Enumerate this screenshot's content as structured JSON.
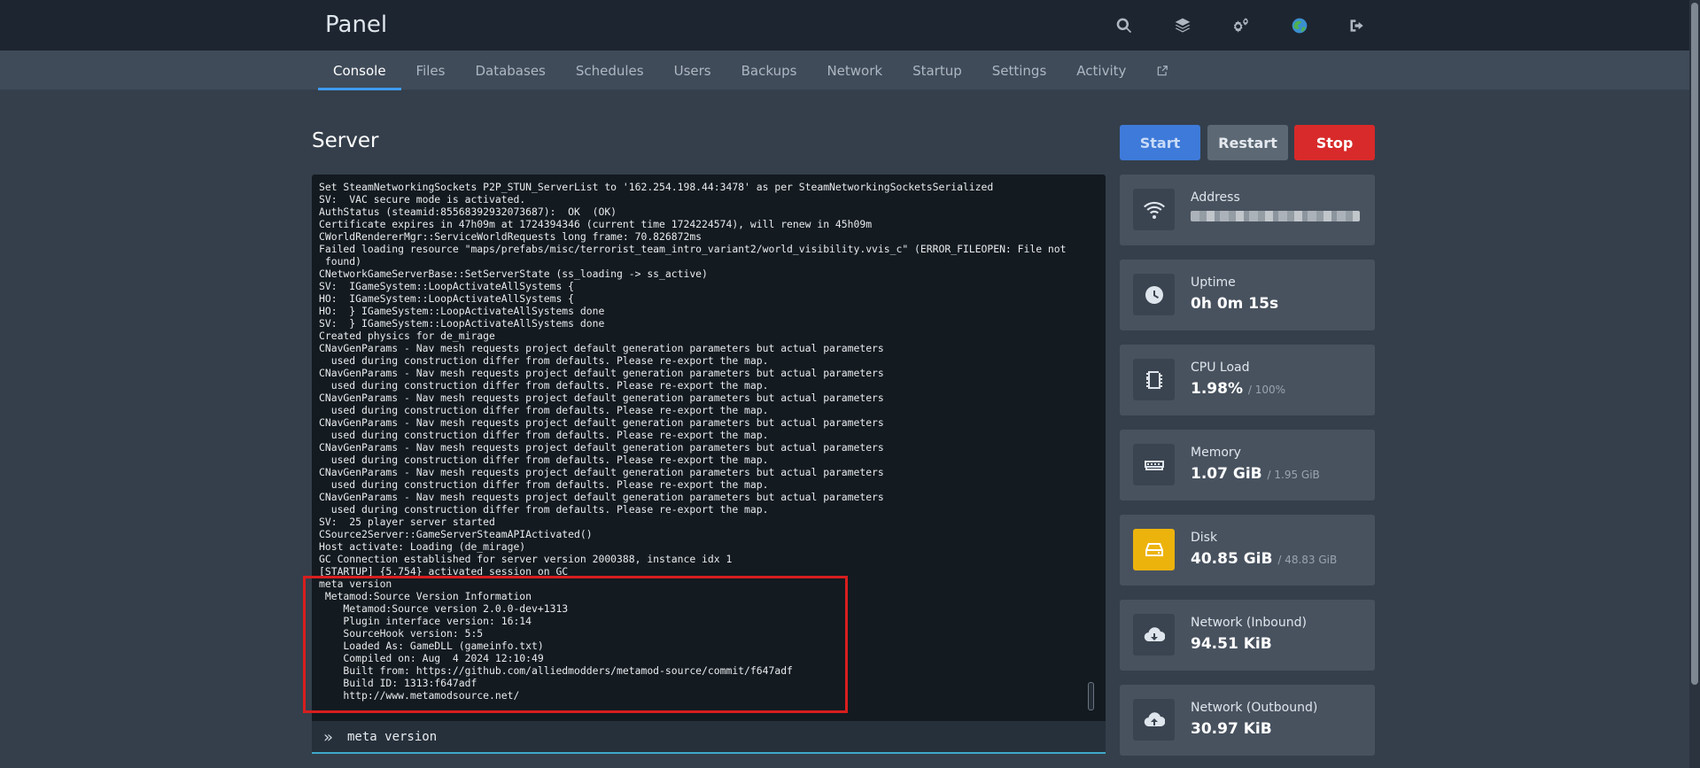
{
  "header": {
    "brand": "Panel",
    "icons": [
      "search-icon",
      "layers-icon",
      "cogs-icon",
      "avatar-icon",
      "logout-icon"
    ]
  },
  "nav": {
    "tabs": [
      {
        "label": "Console",
        "active": true
      },
      {
        "label": "Files"
      },
      {
        "label": "Databases"
      },
      {
        "label": "Schedules"
      },
      {
        "label": "Users"
      },
      {
        "label": "Backups"
      },
      {
        "label": "Network"
      },
      {
        "label": "Startup"
      },
      {
        "label": "Settings"
      },
      {
        "label": "Activity"
      }
    ],
    "external_icon": "external-link-icon"
  },
  "page": {
    "title": "Server"
  },
  "power": {
    "start": "Start",
    "restart": "Restart",
    "stop": "Stop"
  },
  "console": {
    "lines": [
      "Set SteamNetworkingSockets P2P_STUN_ServerList to '162.254.198.44:3478' as per SteamNetworkingSocketsSerialized",
      "SV:  VAC secure mode is activated.",
      "AuthStatus (steamid:85568392932073687):  OK  (OK)",
      "Certificate expires in 47h09m at 1724394346 (current time 1724224574), will renew in 45h09m",
      "CWorldRendererMgr::ServiceWorldRequests long frame: 70.826872ms",
      "Failed loading resource \"maps/prefabs/misc/terrorist_team_intro_variant2/world_visibility.vvis_c\" (ERROR_FILEOPEN: File not",
      " found)",
      "CNetworkGameServerBase::SetServerState (ss_loading -> ss_active)",
      "SV:  IGameSystem::LoopActivateAllSystems {",
      "HO:  IGameSystem::LoopActivateAllSystems {",
      "HO:  } IGameSystem::LoopActivateAllSystems done",
      "SV:  } IGameSystem::LoopActivateAllSystems done",
      "Created physics for de_mirage",
      "CNavGenParams - Nav mesh requests project default generation parameters but actual parameters",
      "  used during construction differ from defaults. Please re-export the map.",
      "CNavGenParams - Nav mesh requests project default generation parameters but actual parameters",
      "  used during construction differ from defaults. Please re-export the map.",
      "CNavGenParams - Nav mesh requests project default generation parameters but actual parameters",
      "  used during construction differ from defaults. Please re-export the map.",
      "CNavGenParams - Nav mesh requests project default generation parameters but actual parameters",
      "  used during construction differ from defaults. Please re-export the map.",
      "CNavGenParams - Nav mesh requests project default generation parameters but actual parameters",
      "  used during construction differ from defaults. Please re-export the map.",
      "CNavGenParams - Nav mesh requests project default generation parameters but actual parameters",
      "  used during construction differ from defaults. Please re-export the map.",
      "CNavGenParams - Nav mesh requests project default generation parameters but actual parameters",
      "  used during construction differ from defaults. Please re-export the map.",
      "SV:  25 player server started",
      "CSource2Server::GameServerSteamAPIActivated()",
      "Host activate: Loading (de_mirage)",
      "GC Connection established for server version 2000388, instance idx 1",
      "[STARTUP] {5.754} activated session on GC",
      "meta version",
      " Metamod:Source Version Information",
      "    Metamod:Source version 2.0.0-dev+1313",
      "    Plugin interface version: 16:14",
      "    SourceHook version: 5:5",
      "    Loaded As: GameDLL (gameinfo.txt)",
      "    Compiled on: Aug  4 2024 12:10:49",
      "    Built from: https://github.com/alliedmodders/metamod-source/commit/f647adf",
      "    Build ID: 1313:f647adf",
      "    http://www.metamodsource.net/"
    ],
    "prompt_icon": "»",
    "command_value": "meta version"
  },
  "stats": {
    "address": {
      "label": "Address",
      "icon": "wifi-icon"
    },
    "uptime": {
      "label": "Uptime",
      "value": "0h 0m 15s",
      "icon": "clock-icon"
    },
    "cpu": {
      "label": "CPU Load",
      "value": "1.98%",
      "limit": "/ 100%",
      "icon": "cpu-icon"
    },
    "memory": {
      "label": "Memory",
      "value": "1.07 GiB",
      "limit": "/ 1.95 GiB",
      "icon": "memory-icon"
    },
    "disk": {
      "label": "Disk",
      "value": "40.85 GiB",
      "limit": "/ 48.83 GiB",
      "icon": "hdd-icon",
      "color": "#edb30d"
    },
    "net_in": {
      "label": "Network (Inbound)",
      "value": "94.51 KiB",
      "icon": "cloud-download-icon"
    },
    "net_out": {
      "label": "Network (Outbound)",
      "value": "30.97 KiB",
      "icon": "cloud-upload-icon"
    }
  },
  "colors": {
    "accent": "#3f9bf0",
    "start": "#3e7ad9",
    "restart": "#5c6975",
    "stop": "#d82a2a",
    "highlight": "#d81e1e"
  }
}
